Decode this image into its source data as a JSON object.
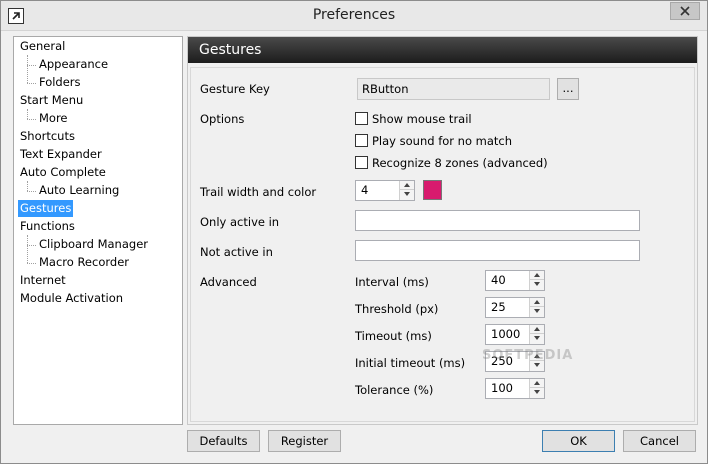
{
  "window": {
    "title": "Preferences"
  },
  "colors": {
    "selection": "#3399ff",
    "trail_color": "#d81b6e"
  },
  "icons": {
    "app": "arrow-window-icon",
    "close": "close-icon",
    "spin_up": "spin-up-arrow-icon",
    "spin_down": "spin-down-arrow-icon"
  },
  "sidebar": {
    "items": [
      {
        "label": "General",
        "level": 0
      },
      {
        "label": "Appearance",
        "level": 1
      },
      {
        "label": "Folders",
        "level": 1
      },
      {
        "label": "Start Menu",
        "level": 0
      },
      {
        "label": "More",
        "level": 1
      },
      {
        "label": "Shortcuts",
        "level": 0
      },
      {
        "label": "Text Expander",
        "level": 0
      },
      {
        "label": "Auto Complete",
        "level": 0
      },
      {
        "label": "Auto Learning",
        "level": 1
      },
      {
        "label": "Gestures",
        "level": 0,
        "selected": true
      },
      {
        "label": "Functions",
        "level": 0
      },
      {
        "label": "Clipboard Manager",
        "level": 1
      },
      {
        "label": "Macro Recorder",
        "level": 1
      },
      {
        "label": "Internet",
        "level": 0
      },
      {
        "label": "Module Activation",
        "level": 0
      }
    ]
  },
  "panel": {
    "title": "Gestures",
    "gesture_key_label": "Gesture Key",
    "gesture_key_value": "RButton",
    "browse_label": "...",
    "options_label": "Options",
    "options": [
      {
        "label": "Show mouse trail",
        "checked": false
      },
      {
        "label": "Play sound for no match",
        "checked": false
      },
      {
        "label": "Recognize 8 zones (advanced)",
        "checked": false
      }
    ],
    "trail_label": "Trail width and color",
    "trail_width": "4",
    "only_active_label": "Only active in",
    "only_active_value": "",
    "not_active_label": "Not active in",
    "not_active_value": "",
    "advanced_label": "Advanced",
    "advanced": [
      {
        "label": "Interval (ms)",
        "value": "40"
      },
      {
        "label": "Threshold (px)",
        "value": "25"
      },
      {
        "label": "Timeout (ms)",
        "value": "1000"
      },
      {
        "label": "Initial timeout (ms)",
        "value": "250"
      },
      {
        "label": "Tolerance (%)",
        "value": "100"
      }
    ],
    "watermark": "SOFTPEDIA"
  },
  "footer": {
    "defaults": "Defaults",
    "register": "Register",
    "ok": "OK",
    "cancel": "Cancel"
  }
}
